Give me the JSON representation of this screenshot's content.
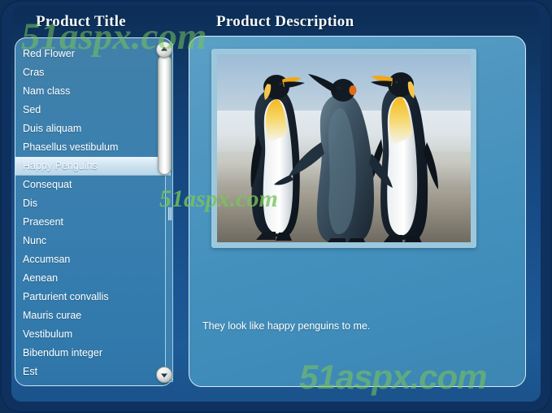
{
  "window": {
    "accent_color": "#1b5490",
    "frame_color": "#0e3160",
    "panel_color": "#4390bd"
  },
  "headings": {
    "product_title": "Product Title",
    "product_description": "Product Description"
  },
  "product_list": {
    "selected_index": 6,
    "items": [
      {
        "label": "Red Flower"
      },
      {
        "label": "Cras"
      },
      {
        "label": "Nam class"
      },
      {
        "label": "Sed"
      },
      {
        "label": "Duis aliquam"
      },
      {
        "label": "Phasellus vestibulum"
      },
      {
        "label": "Happy Penguins"
      },
      {
        "label": "Consequat"
      },
      {
        "label": "Dis"
      },
      {
        "label": "Praesent"
      },
      {
        "label": "Nunc"
      },
      {
        "label": "Accumsan"
      },
      {
        "label": "Aenean"
      },
      {
        "label": "Parturient convallis"
      },
      {
        "label": "Mauris curae"
      },
      {
        "label": "Vestibulum"
      },
      {
        "label": "Bibendum integer"
      },
      {
        "label": "Est"
      }
    ]
  },
  "scrollbar": {
    "up_arrow_icon": "chevron-up-icon",
    "down_arrow_icon": "chevron-down-icon",
    "thumb_position_percent": 4
  },
  "description": {
    "image_alt": "Three king penguins standing together on a beach",
    "text": "They look like happy penguins to me."
  },
  "watermarks": {
    "color": "#79c45c",
    "top": "51aspx.com",
    "middle": "51aspx.com",
    "bottom": "51aspx.com"
  }
}
